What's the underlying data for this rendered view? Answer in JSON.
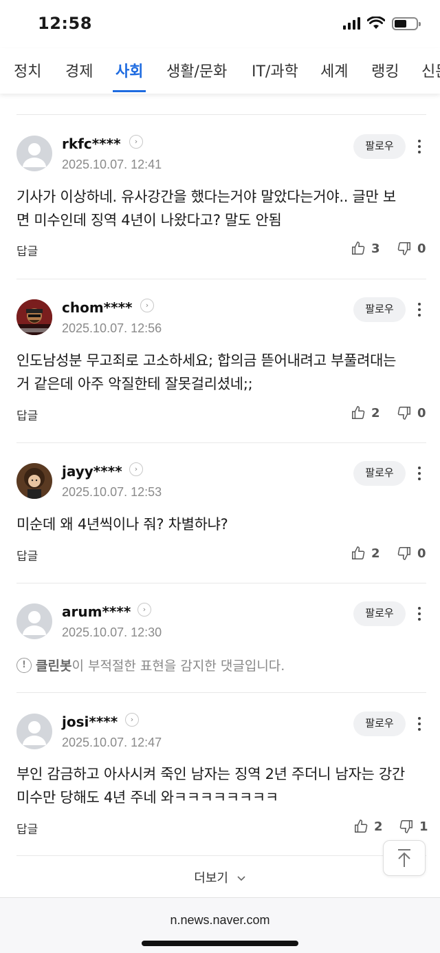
{
  "status": {
    "time": "12:58"
  },
  "nav": {
    "tabs": [
      {
        "label": "정치",
        "active": false
      },
      {
        "label": "경제",
        "active": false
      },
      {
        "label": "사회",
        "active": true
      },
      {
        "label": "생활/문화",
        "active": false
      },
      {
        "label": "IT/과학",
        "active": false
      },
      {
        "label": "세계",
        "active": false
      },
      {
        "label": "랭킹",
        "active": false
      },
      {
        "label": "신문",
        "active": false
      }
    ]
  },
  "labels": {
    "follow": "팔로우",
    "reply": "답글",
    "load_more": "더보기"
  },
  "comments": [
    {
      "author": "rkfc****",
      "date": "2025.10.07. 12:41",
      "text": "기사가 이상하네. 유사강간을 했다는거야 말았다는거야.. 글만 보면 미수인데 징역 4년이 나왔다고? 말도 안됨",
      "likes": "3",
      "dislikes": "0"
    },
    {
      "author": "chom****",
      "date": "2025.10.07. 12:56",
      "text": "인도남성분 무고죄로 고소하세요; 합의금 뜯어내려고 부풀려대는거 같은데 아주 악질한테 잘못걸리셨네;;",
      "likes": "2",
      "dislikes": "0"
    },
    {
      "author": "jayy****",
      "date": "2025.10.07. 12:53",
      "text": "미순데 왜 4년씩이나 줘? 차별하냐?",
      "likes": "2",
      "dislikes": "0"
    },
    {
      "author": "arum****",
      "date": "2025.10.07. 12:30",
      "cleanbot_name": "클린봇",
      "cleanbot_message": "이 부적절한 표현을 감지한 댓글입니다."
    },
    {
      "author": "josi****",
      "date": "2025.10.07. 12:47",
      "text": "부인 감금하고 아사시켜 죽인 남자는 징역 2년 주더니 남자는 강간미수만 당해도 4년 주네 와ㅋㅋㅋㅋㅋㅋㅋㅋ",
      "likes": "2",
      "dislikes": "1"
    }
  ],
  "browser": {
    "url": "n.news.naver.com"
  },
  "colors": {
    "accent": "#1e6be0",
    "muted": "#8a8a8a",
    "follow_bg": "#f0f1f3"
  }
}
